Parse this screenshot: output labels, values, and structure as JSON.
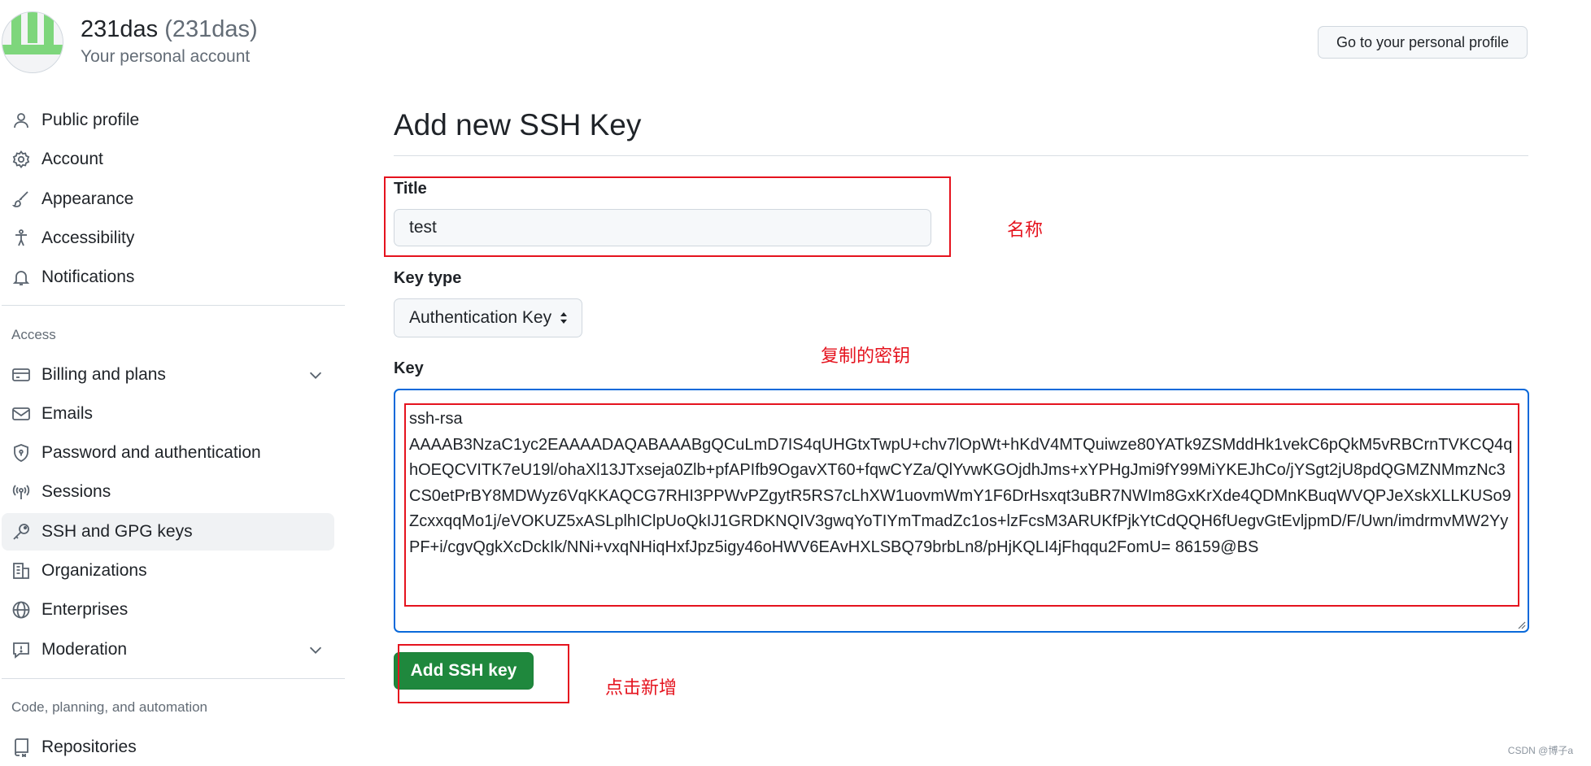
{
  "header": {
    "account_name": "231das",
    "account_handle": "(231das)",
    "account_subtitle": "Your personal account",
    "profile_button": "Go to your personal profile"
  },
  "sidebar": {
    "top_items": [
      {
        "label": "Public profile",
        "icon": "person-icon"
      },
      {
        "label": "Account",
        "icon": "gear-icon"
      },
      {
        "label": "Appearance",
        "icon": "paintbrush-icon"
      },
      {
        "label": "Accessibility",
        "icon": "accessibility-icon"
      },
      {
        "label": "Notifications",
        "icon": "bell-icon"
      }
    ],
    "access_label": "Access",
    "access_items": [
      {
        "label": "Billing and plans",
        "icon": "credit-card-icon",
        "expandable": true
      },
      {
        "label": "Emails",
        "icon": "mail-icon"
      },
      {
        "label": "Password and authentication",
        "icon": "shield-lock-icon"
      },
      {
        "label": "Sessions",
        "icon": "broadcast-icon"
      },
      {
        "label": "SSH and GPG keys",
        "icon": "key-icon",
        "active": true
      },
      {
        "label": "Organizations",
        "icon": "organization-icon"
      },
      {
        "label": "Enterprises",
        "icon": "globe-icon"
      },
      {
        "label": "Moderation",
        "icon": "report-icon",
        "expandable": true
      }
    ],
    "code_label": "Code, planning, and automation",
    "code_items": [
      {
        "label": "Repositories",
        "icon": "repo-icon"
      }
    ]
  },
  "main": {
    "title": "Add new SSH Key",
    "title_field_label": "Title",
    "title_field_value": "test",
    "key_type_label": "Key type",
    "key_type_value": "Authentication Key",
    "key_label": "Key",
    "key_value": "ssh-rsa\nAAAAB3NzaC1yc2EAAAADAQABAAABgQCuLmD7IS4qUHGtxTwpU+chv7lOpWt+hKdV4MTQuiwze80YATk9ZSMddHk1vekC6pQkM5vRBCrnTVKCQ4qhOEQCVITK7eU19l/ohaXl13JTxseja0Zlb+pfAPIfb9OgavXT60+fqwCYZa/QlYvwKGOjdhJms+xYPHgJmi9fY99MiYKEJhCo/jYSgt2jU8pdQGMZNMmzNc3CS0etPrBY8MDWyz6VqKKAQCG7RHI3PPWvPZgytR5RS7cLhXW1uovmWmY1F6DrHsxqt3uBR7NWIm8GxKrXde4QDMnKBuqWVQPJeXskXLLKUSo9ZcxxqqMo1j/eVOKUZ5xASLplhIClpUoQkIJ1GRDKNQIV3gwqYoTIYmTmadZc1os+lzFcsM3ARUKfPjkYtCdQQH6fUegvGtEvljpmD/F/Uwn/imdrmvMW2YyPF+i/cgvQgkXcDckIk/NNi+vxqNHiqHxfJpz5igy46oHWV6EAvHXLSBQ79brbLn8/pHjKQLI4jFhqqu2FomU= 86159@BS",
    "submit_label": "Add SSH key"
  },
  "annotations": {
    "name_note": "名称",
    "key_note": "复制的密钥",
    "click_note": "点击新增"
  },
  "watermark": "CSDN @博子a",
  "colors": {
    "primary_button": "#1f883d",
    "focus_border": "#0969da",
    "annotation_red": "#e5131e",
    "avatar_green": "#7ed67c"
  }
}
